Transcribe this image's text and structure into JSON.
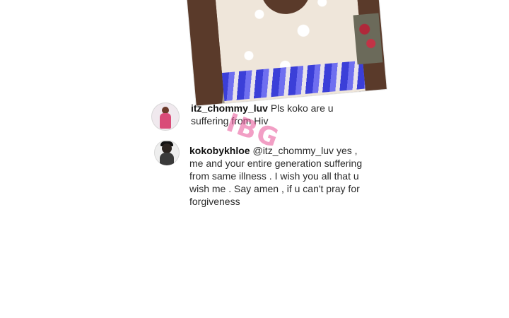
{
  "post": {
    "image_description_icon": "photo-icon"
  },
  "comments": [
    {
      "username": "itz_chommy_luv",
      "text": "Pls koko are u suffering from Hiv"
    },
    {
      "username": "kokobykhloe",
      "text": "@itz_chommy_luv yes , me and your entire generation suffering from same illness . I wish you all that u wish me . Say amen , if u can't pray for forgiveness"
    }
  ],
  "watermark": {
    "text": "IBG"
  },
  "colors": {
    "watermark": "#e75096",
    "username": "#111111",
    "comment_text": "#2a2a2a",
    "background": "#ffffff"
  }
}
